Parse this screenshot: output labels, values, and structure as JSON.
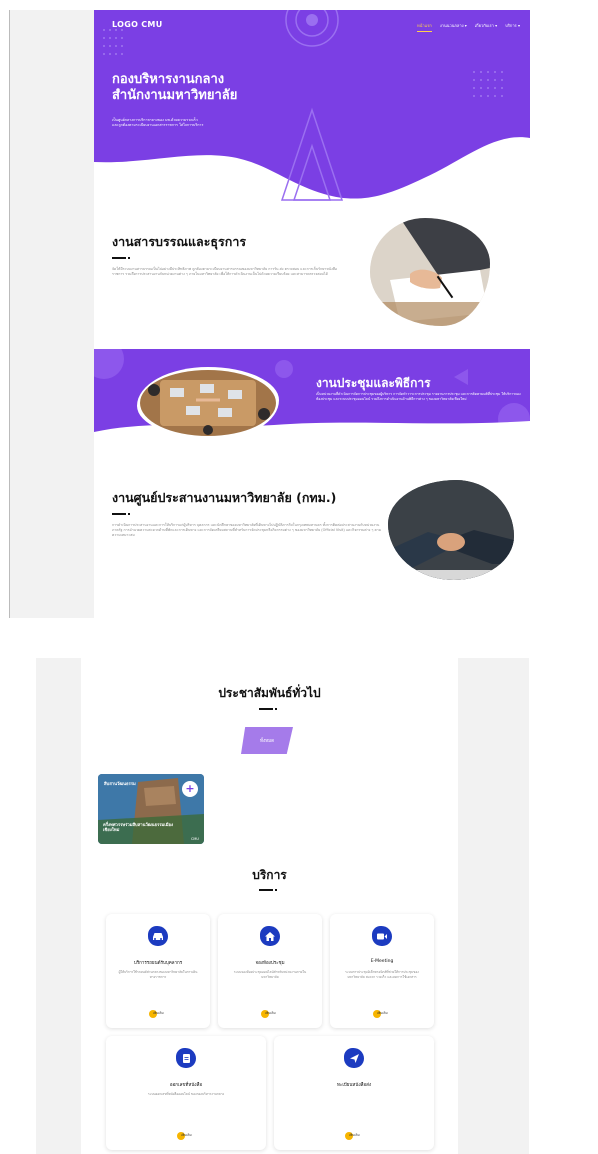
{
  "hero": {
    "logo": "LOGO CMU",
    "nav": [
      "หน้าแรก",
      "งานนวนกลาง ▾",
      "เกี่ยวกับเรา ▾",
      "บริการ ▾"
    ],
    "title_line1": "กองบริหารงานกลาง",
    "title_line2": "สำนักงานมหาวิทยาลัย",
    "subtitle_line1": "เป็นศูนย์กลางการบริการกลางของ มช.ด้วยความรวดเร็ว",
    "subtitle_line2": "และถูกต้องตามระเบียบงานเอกสารราชการ ใส่ใจการบริการ"
  },
  "sections": {
    "saraban": {
      "title": "งานสารบรรณและธุรการ",
      "text": "จัดให้มีระบบงานสารบรรณเป็นไปอย่างมีประสิทธิภาพ ถูกต้องตามระเบียบงานสารบรรณของมหาวิทยาลัย การรับ-ส่ง ตรวจสอบ และการเก็บรักษาหนังสือราชการ รวมถึงการประสานงานกับหน่วยงานต่าง ๆ ภายในมหาวิทยาลัย เพื่อให้การดำเนินงานเป็นไปด้วยความเรียบร้อย และสามารถตรวจสอบได้"
    },
    "meeting": {
      "title": "งานประชุมและพิธีการ",
      "text": "เป็นหน่วยงานที่ดำเนินการจัดการประชุมของผู้บริหาร การจัดทำวาระการประชุม รายงานการประชุม และการติดตามมติที่ประชุม ให้บริการจองห้องประชุม และระบบประชุมออนไลน์ รวมถึงการดำเนินงานด้านพิธีการต่าง ๆ ของมหาวิทยาลัยเชียงใหม่"
    },
    "center": {
      "title": "งานศูนย์ประสานงานมหาวิทยาลัย (กทม.)",
      "text": "การดำเนินการประสานงานและการให้บริการแก่ผู้บริหาร บุคลากร และนักศึกษาของมหาวิทยาลัยที่เดินทางไปปฏิบัติภารกิจในกรุงเทพมหานคร ทั้งการติดต่อประสานงานกับหน่วยงานภาครัฐ การอำนวยความสะดวกด้านที่พักและการเดินทาง และการจัดเตรียมสถานที่สำหรับการจัดประชุมหรือกิจกรรมต่าง ๆ ของมหาวิทยาลัย (Official Visit) และกิจกรรมต่าง ๆ ตามความเหมาะสม"
    }
  },
  "news": {
    "heading": "ประชาสัมพันธ์ทั่วไป",
    "filter_label": "ทั้งหมด",
    "card_overlay": "สืบสานวัฒนธรรม",
    "card_title": "ครึ่งทศวรรษร่วมสืบสานวัฒนธรรมเมืองเชียงใหม่",
    "card_tag": "CMU"
  },
  "services": {
    "heading": "บริการ",
    "items": [
      {
        "title": "บริการรถยนต์รับบุคลากร",
        "desc": "ผู้ให้บริการใช้รถยนต์ส่วนกลางของมหาวิทยาลัยในการเดินทางราชการ",
        "more": "เพิ่มเติม",
        "icon": "car-icon"
      },
      {
        "title": "จองห้องประชุม",
        "desc": "ระบบจองห้องประชุมออนไลน์สำหรับหน่วยงานภายในมหาวิทยาลัย",
        "more": "เพิ่มเติม",
        "icon": "home-icon"
      },
      {
        "title": "E-Meeting",
        "desc": "ระบบการประชุมอิเล็กทรอนิกส์ที่ช่วยให้การประชุมของมหาวิทยาลัย สะดวก รวดเร็ว และลดการใช้เอกสาร",
        "more": "เพิ่มเติม",
        "icon": "video-camera-icon"
      },
      {
        "title": "ออกเลขที่หนังสือ",
        "desc": "ระบบออกเลขที่หนังสือออนไลน์ ของกองบริหารงานกลาง",
        "more": "เพิ่มเติม",
        "icon": "document-icon"
      },
      {
        "title": "ทะเบียนหนังสือส่ง",
        "desc": "",
        "more": "เพิ่มเติม",
        "icon": "send-icon"
      }
    ]
  },
  "colors": {
    "purple": "#7b3fe4",
    "accent": "#f7b500",
    "icon_blue": "#1c3bc0"
  }
}
